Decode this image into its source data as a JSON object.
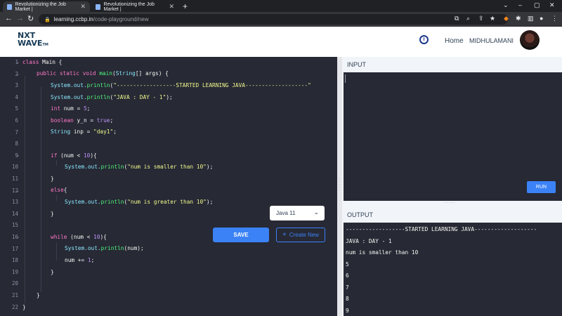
{
  "browser": {
    "tabs": [
      {
        "title": "Revolutionizing the Job Market | "
      },
      {
        "title": "Revolutionizing the Job Market | "
      }
    ],
    "new_tab": "+",
    "url_host": "learning.ccbp.in",
    "url_path": "/code-playground/new"
  },
  "header": {
    "logo_line1": "NXT",
    "logo_line2": "WAVE",
    "logo_tm": "TM",
    "home": "Home",
    "user_name": "MIDHULAMANI"
  },
  "editor": {
    "line_numbers": [
      "1",
      "2",
      "3",
      "4",
      "5",
      "6",
      "7",
      "8",
      "9",
      "10",
      "11",
      "12",
      "13",
      "14",
      "15",
      "16",
      "17",
      "18",
      "19",
      "20",
      "21",
      "22"
    ],
    "tokens": {
      "l1": [
        "class",
        " Main {"
      ],
      "l2": [
        "public static void",
        " ",
        "main",
        "(",
        "String",
        "[] args) {"
      ],
      "l3": [
        "System.out.",
        "println",
        "(",
        "\"------------------STARTED LEARNING JAVA-------------------\""
      ],
      "l4": [
        "System.out.",
        "println",
        "(",
        "\"JAVA : DAY - 1\"",
        ");"
      ],
      "l5": [
        "int",
        " num = ",
        "5",
        ";"
      ],
      "l6": [
        "boolean",
        " y_n = ",
        "true",
        ";"
      ],
      "l7": [
        "String",
        " inp = ",
        "\"day1\"",
        ";"
      ],
      "l9": [
        "if",
        " (num < ",
        "10",
        "){"
      ],
      "l10": [
        "System.out.",
        "println",
        "(",
        "\"num is smaller than 10\"",
        ");"
      ],
      "l11": [
        "}"
      ],
      "l12": [
        "else",
        "{"
      ],
      "l13": [
        "System.out.",
        "println",
        "(",
        "\"num is greater than 10\"",
        ");"
      ],
      "l14": [
        "}"
      ],
      "l16": [
        "while",
        " (num < ",
        "10",
        "){"
      ],
      "l17": [
        "System.out.",
        "println",
        "(num);"
      ],
      "l18": [
        "num += ",
        "1",
        ";"
      ],
      "l19": [
        "}"
      ],
      "l21": [
        "}"
      ],
      "l22": [
        "}"
      ]
    }
  },
  "controls": {
    "language": "Java 11",
    "save": "SAVE",
    "create_new": "Create New",
    "run": "RUN"
  },
  "panels": {
    "input_label": "INPUT",
    "output_label": "OUTPUT"
  },
  "output": {
    "lines": [
      "------------------STARTED LEARNING JAVA-------------------",
      "JAVA : DAY - 1",
      "num is smaller than 10",
      "5",
      "6",
      "7",
      "8",
      "9"
    ]
  },
  "colors": {
    "editor_bg": "#272935",
    "accent_blue": "#3b82f6",
    "keyword": "#ff79c6",
    "function": "#50fa7b",
    "type": "#8be9fd",
    "string": "#f1fa8c",
    "number": "#bd93f9"
  }
}
